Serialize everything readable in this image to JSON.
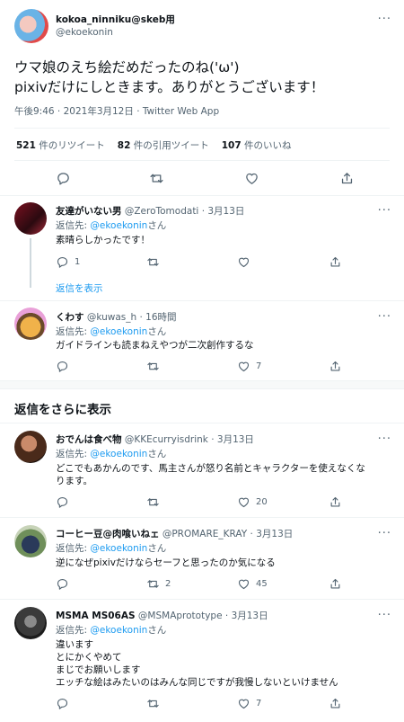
{
  "main_tweet": {
    "display_name": "kokoa_ninniku@skeb用",
    "handle": "@ekoekonin",
    "more_glyph": "···",
    "text_line1": "ウマ娘のえち絵だめだったのね('ω')",
    "text_line2": "pixivだけにしときます。ありがとうございます！",
    "meta": "午後9:46 · 2021年3月12日 · Twitter Web App",
    "stats": {
      "retweets_count": "521",
      "retweets_label": "件のリツイート",
      "quotes_count": "82",
      "quotes_label": "件の引用ツイート",
      "likes_count": "107",
      "likes_label": "件のいいね"
    }
  },
  "reply_to_label": "返信先:",
  "reply_to_handle": "@ekoekonin",
  "reply_to_suffix": "さん",
  "show_replies_link": "返信を表示",
  "more_replies_heading": "返信をさらに表示",
  "replies": [
    {
      "display_name": "友達がいない男",
      "handle": "@ZeroTomodati",
      "time": "· 3月13日",
      "lines": [
        "素晴らしかったです！"
      ],
      "reply_count": "1",
      "retweet_count": "",
      "like_count": ""
    },
    {
      "display_name": "くわす",
      "handle": "@kuwas_h",
      "time": "· 16時間",
      "lines": [
        "ガイドラインも読まねえやつが二次創作するな"
      ],
      "reply_count": "",
      "retweet_count": "",
      "like_count": "7"
    },
    {
      "display_name": "おでんは食べ物",
      "handle": "@KKEcurryisdrink",
      "time": "· 3月13日",
      "lines": [
        "どこでもあかんのです、馬主さんが怒り名前とキャラクターを使えなくな",
        "ります。"
      ],
      "reply_count": "",
      "retweet_count": "",
      "like_count": "20"
    },
    {
      "display_name": "コーヒー豆@肉喰いねェ",
      "handle": "@PROMARE_KRAY",
      "time": "· 3月13日",
      "lines": [
        "逆になぜpixivだけならセーフと思ったのか気になる"
      ],
      "reply_count": "",
      "retweet_count": "2",
      "like_count": "45"
    },
    {
      "display_name": "MSMA MS06AS",
      "handle": "@MSMAprototype",
      "time": "· 3月13日",
      "lines": [
        "違います",
        "とにかくやめて",
        "まじでお願いします",
        "エッチな絵はみたいのはみんな同じですが我慢しないといけません"
      ],
      "reply_count": "",
      "retweet_count": "",
      "like_count": "7"
    }
  ],
  "colors": {
    "accent": "#1d9bf0",
    "muted": "#536471",
    "text": "#0f1419",
    "divider": "#eff3f4"
  },
  "icons": [
    "reply-icon",
    "retweet-icon",
    "like-icon",
    "share-icon",
    "more-icon"
  ]
}
